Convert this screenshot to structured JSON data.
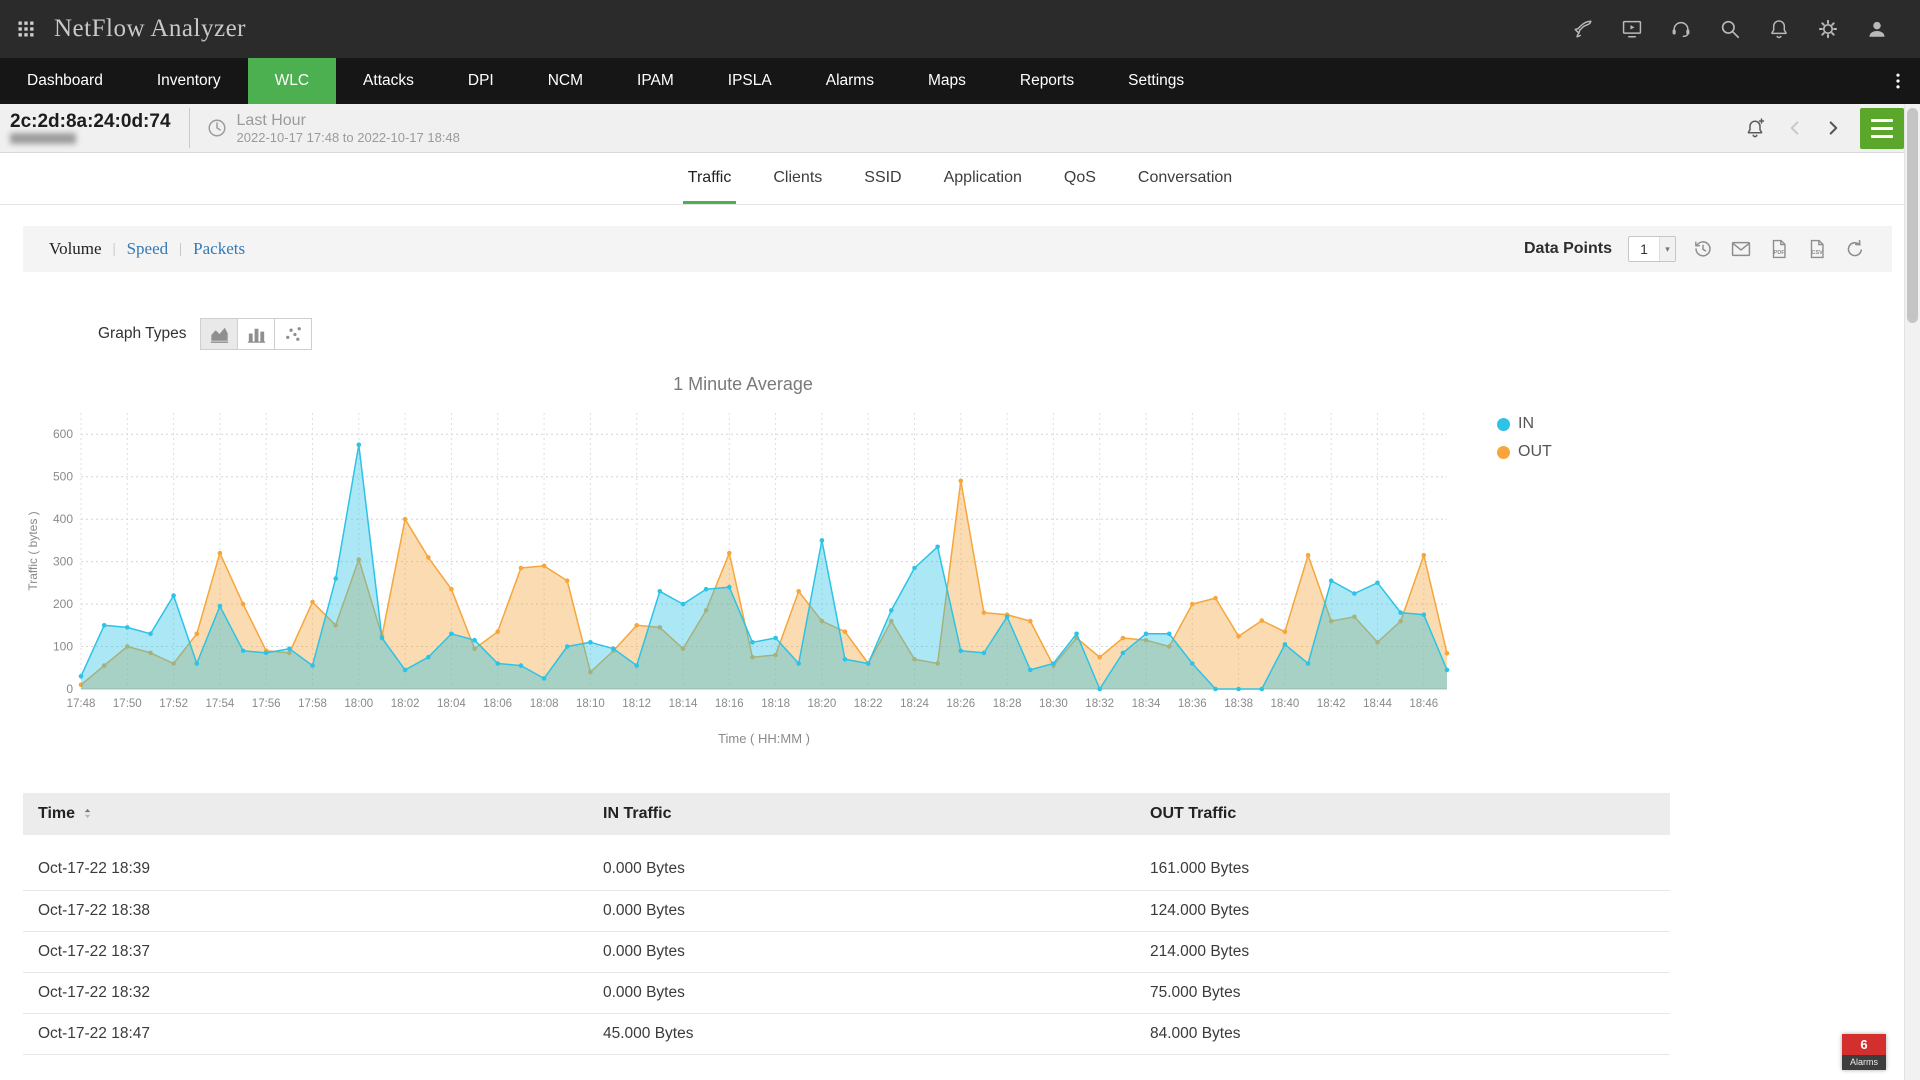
{
  "header": {
    "title": "NetFlow Analyzer",
    "icons": [
      "rocket-icon",
      "screen-share-icon",
      "support-icon",
      "search-icon",
      "notifications-icon",
      "settings-icon",
      "user-avatar-icon"
    ]
  },
  "nav": {
    "items": [
      "Dashboard",
      "Inventory",
      "WLC",
      "Attacks",
      "DPI",
      "NCM",
      "IPAM",
      "IPSLA",
      "Alarms",
      "Maps",
      "Reports",
      "Settings"
    ],
    "active": "WLC"
  },
  "subheader": {
    "device_id": "2c:2d:8a:24:0d:74",
    "time_range_label": "Last Hour",
    "time_range": "2022-10-17 17:48 to 2022-10-17 18:48"
  },
  "view_tabs": {
    "items": [
      "Traffic",
      "Clients",
      "SSID",
      "Application",
      "QoS",
      "Conversation"
    ],
    "active": "Traffic"
  },
  "toolbar": {
    "metric_views": [
      "Volume",
      "Speed",
      "Packets"
    ],
    "active_view": "Volume",
    "data_points_label": "Data Points",
    "data_points_value": "1",
    "icons": [
      "schedule-icon",
      "email-icon",
      "export-pdf-icon",
      "export-csv-icon",
      "reset-icon"
    ]
  },
  "graph_types": {
    "label": "Graph Types",
    "options": [
      "area",
      "column",
      "scatter"
    ],
    "selected": "area"
  },
  "chart_data": {
    "type": "area",
    "title": "1 Minute Average",
    "xlabel": "Time ( HH:MM )",
    "ylabel": "Traffic ( bytes )",
    "ylim": [
      0,
      650
    ],
    "ytick_step": 100,
    "ytick_max": 600,
    "grid": "dotted",
    "legend_position": "right",
    "x": [
      "17:48",
      "17:49",
      "17:50",
      "17:51",
      "17:52",
      "17:53",
      "17:54",
      "17:55",
      "17:56",
      "17:57",
      "17:58",
      "17:59",
      "18:00",
      "18:01",
      "18:02",
      "18:03",
      "18:04",
      "18:05",
      "18:06",
      "18:07",
      "18:08",
      "18:09",
      "18:10",
      "18:11",
      "18:12",
      "18:13",
      "18:14",
      "18:15",
      "18:16",
      "18:17",
      "18:18",
      "18:19",
      "18:20",
      "18:21",
      "18:22",
      "18:23",
      "18:24",
      "18:25",
      "18:26",
      "18:27",
      "18:28",
      "18:29",
      "18:30",
      "18:31",
      "18:32",
      "18:33",
      "18:34",
      "18:35",
      "18:36",
      "18:37",
      "18:38",
      "18:39",
      "18:40",
      "18:41",
      "18:42",
      "18:43",
      "18:44",
      "18:45",
      "18:46",
      "18:47"
    ],
    "series": [
      {
        "name": "IN",
        "color": "#2cc3e6",
        "values": [
          30,
          150,
          145,
          130,
          220,
          60,
          195,
          90,
          85,
          95,
          55,
          260,
          575,
          120,
          45,
          75,
          130,
          115,
          60,
          55,
          25,
          100,
          110,
          95,
          55,
          230,
          200,
          235,
          240,
          110,
          120,
          60,
          350,
          70,
          60,
          185,
          285,
          335,
          90,
          85,
          170,
          45,
          60,
          130,
          0,
          85,
          130,
          130,
          60,
          0,
          0,
          0,
          105,
          60,
          255,
          225,
          250,
          180,
          175,
          45
        ]
      },
      {
        "name": "OUT",
        "color": "#f6a63b",
        "values": [
          10,
          55,
          100,
          85,
          60,
          130,
          320,
          200,
          90,
          85,
          205,
          150,
          305,
          125,
          400,
          310,
          235,
          95,
          135,
          285,
          290,
          255,
          40,
          90,
          150,
          145,
          95,
          185,
          320,
          75,
          80,
          230,
          160,
          135,
          60,
          160,
          70,
          60,
          490,
          180,
          175,
          160,
          55,
          120,
          75,
          120,
          115,
          100,
          200,
          214,
          124,
          161,
          135,
          315,
          160,
          170,
          110,
          160,
          315,
          84
        ]
      }
    ]
  },
  "table": {
    "columns": [
      "Time",
      "IN Traffic",
      "OUT Traffic"
    ],
    "sorted_column": "Time",
    "rows": [
      [
        "Oct-17-22 18:39",
        "0.000 Bytes",
        "161.000 Bytes"
      ],
      [
        "Oct-17-22 18:38",
        "0.000 Bytes",
        "124.000 Bytes"
      ],
      [
        "Oct-17-22 18:37",
        "0.000 Bytes",
        "214.000 Bytes"
      ],
      [
        "Oct-17-22 18:32",
        "0.000 Bytes",
        "75.000 Bytes"
      ],
      [
        "Oct-17-22 18:47",
        "45.000 Bytes",
        "84.000 Bytes"
      ]
    ]
  },
  "alarms_badge": {
    "count": "6",
    "label": "Alarms"
  },
  "colors": {
    "accent_green": "#4caf50",
    "menu_button_green": "#5aa72c",
    "link_blue": "#337ab7",
    "in_series": "#2cc3e6",
    "out_series": "#f6a63b",
    "alarm_red": "#d32f2f"
  }
}
